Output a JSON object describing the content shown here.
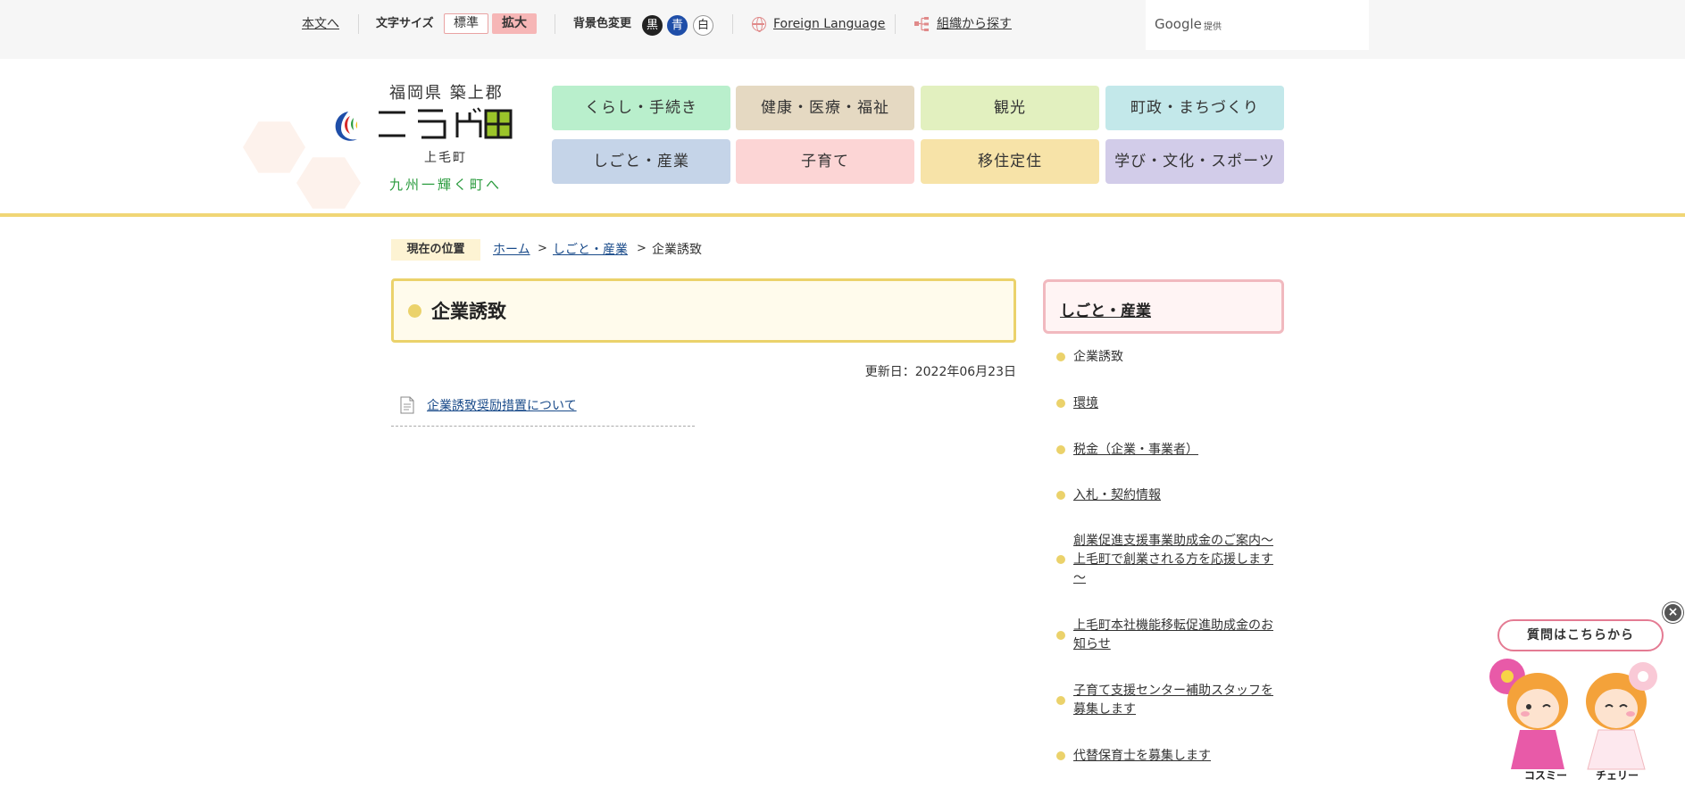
{
  "topbar": {
    "skip_link": "本文へ",
    "font_size_label": "文字サイズ",
    "font_size_standard": "標準",
    "font_size_large": "拡大",
    "bg_color_label": "背景色変更",
    "bg_black": "黒",
    "bg_blue": "青",
    "bg_white": "白",
    "foreign_language": "Foreign Language",
    "org_search": "組織から探す",
    "google": "Google",
    "google_provided": "提供"
  },
  "header": {
    "prefecture": "福岡県 築上郡",
    "town_reading": "上毛町",
    "catchphrase": "九州一輝く町へ"
  },
  "global_nav": [
    {
      "label": "くらし・手続き",
      "color": "#b9efcc"
    },
    {
      "label": "健康・医療・福祉",
      "color": "#e5d9c2"
    },
    {
      "label": "観光",
      "color": "#e2f0bf"
    },
    {
      "label": "町政・まちづくり",
      "color": "#c3e8ea"
    },
    {
      "label": "しごと・産業",
      "color": "#c5d4e8"
    },
    {
      "label": "子育て",
      "color": "#fcd5d5"
    },
    {
      "label": "移住定住",
      "color": "#f7e3a8"
    },
    {
      "label": "学び・文化・スポーツ",
      "color": "#d2cce9"
    }
  ],
  "breadcrumb": {
    "label": "現在の位置",
    "home": "ホーム",
    "parent": "しごと・産業",
    "current": "企業誘致"
  },
  "main": {
    "title": "企業誘致",
    "updated": "更新日：2022年06月23日",
    "doc_link": "企業誘致奨励措置について"
  },
  "side_nav": {
    "heading": "しごと・産業",
    "items": [
      {
        "label": "企業誘致",
        "current": true
      },
      {
        "label": "環境",
        "current": false
      },
      {
        "label": "税金（企業・事業者）",
        "current": false
      },
      {
        "label": "入札・契約情報",
        "current": false
      },
      {
        "label": "創業促進支援事業助成金のご案内～上毛町で創業される方を応援します～",
        "current": false
      },
      {
        "label": "上毛町本社機能移転促進助成金のお知らせ",
        "current": false
      },
      {
        "label": "子育て支援センター補助スタッフを募集します",
        "current": false
      },
      {
        "label": "代替保育士を募集します",
        "current": false
      }
    ]
  },
  "chat": {
    "bubble": "質問はこちらから",
    "char_left": "コスミー",
    "char_right": "チェリー",
    "close": "×"
  },
  "colors": {
    "accent_yellow": "#ebd26b",
    "link_blue": "#1a4b8a",
    "side_pink": "#f1b9bf"
  }
}
